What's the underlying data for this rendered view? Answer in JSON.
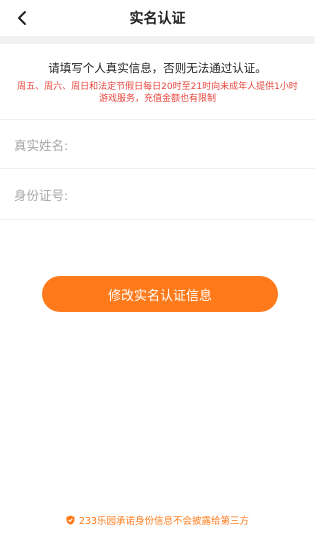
{
  "header": {
    "title": "实名认证",
    "back_icon": "chevron-left-icon"
  },
  "notice": {
    "main": "请填写个人真实信息，否则无法通过认证。",
    "warning": "周五、周六、周日和法定节假日每日20时至21时向未成年人提供1小时游戏服务，充值金额也有限制"
  },
  "form": {
    "name_label": "真实姓名:",
    "id_label": "身份证号:"
  },
  "action": {
    "button_label": "修改实名认证信息"
  },
  "footer": {
    "icon": "shield-icon",
    "text": "233乐园承诺身份信息不会披露给第三方"
  },
  "colors": {
    "accent": "#ff7a1a",
    "warning": "#e8453c"
  }
}
